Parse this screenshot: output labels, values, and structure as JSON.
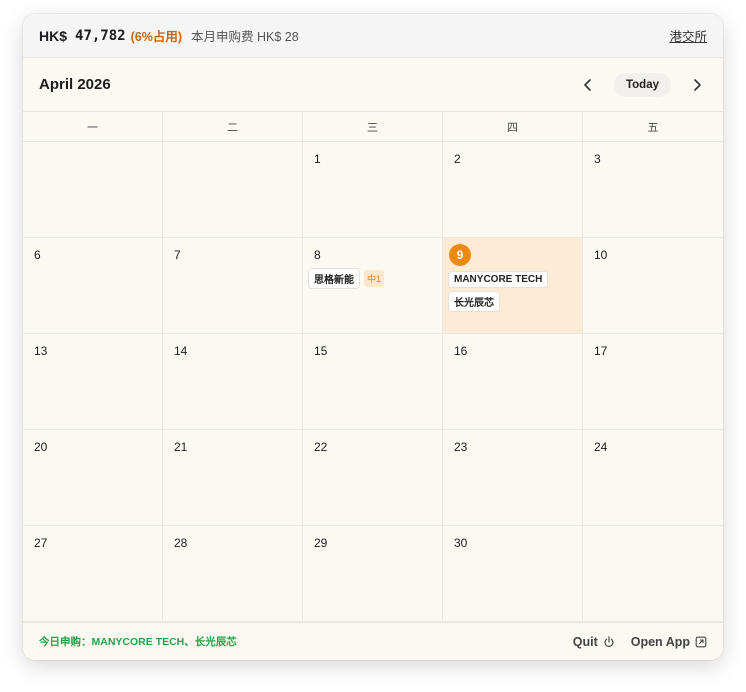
{
  "topbar": {
    "currency": "HK$",
    "amount": "47,782",
    "usage": "(6%占用)",
    "monthly_fee": "本月申购费 HK$ 28",
    "exchange_link": "港交所"
  },
  "calendar": {
    "month_title": "April 2026",
    "today_label": "Today",
    "weekdays": [
      "一",
      "二",
      "三",
      "四",
      "五"
    ],
    "weeks": [
      [
        "",
        "",
        "1",
        "2",
        "3"
      ],
      [
        "6",
        "7",
        "8",
        "9",
        "10"
      ],
      [
        "13",
        "14",
        "15",
        "16",
        "17"
      ],
      [
        "20",
        "21",
        "22",
        "23",
        "24"
      ],
      [
        "27",
        "28",
        "29",
        "30",
        ""
      ]
    ],
    "today_day": "9",
    "events": {
      "day8": {
        "name": "思格新能",
        "tag": "中1"
      },
      "day9": [
        "MANYCORE TECH",
        "长光辰芯"
      ]
    }
  },
  "footer": {
    "today_subscriptions": "今日申购：MANYCORE TECH、长光辰芯",
    "quit_label": "Quit",
    "open_app_label": "Open App"
  },
  "colors": {
    "accent_orange": "#ee8a12",
    "today_bg": "#fdebd5",
    "green_text": "#22a347"
  }
}
